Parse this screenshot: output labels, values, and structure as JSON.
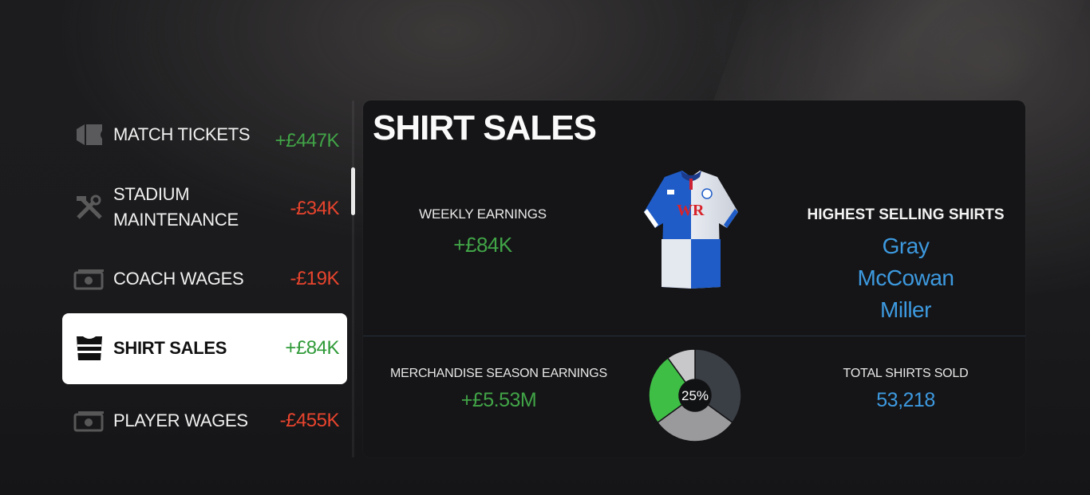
{
  "sidebar": {
    "items": [
      {
        "label_lines": [
          "MATCH TICKETS"
        ],
        "amount": "+£447K",
        "sign": "positive",
        "icon": "ticket-icon",
        "active": false
      },
      {
        "label_lines": [
          "STADIUM",
          "MAINTENANCE"
        ],
        "amount": "-£34K",
        "sign": "negative",
        "icon": "wrench-hammer-icon",
        "active": false
      },
      {
        "label_lines": [
          "COACH WAGES"
        ],
        "amount": "-£19K",
        "sign": "negative",
        "icon": "cash-icon",
        "active": false
      },
      {
        "label_lines": [
          "SHIRT SALES"
        ],
        "amount": "+£84K",
        "sign": "positive",
        "icon": "shirt-icon",
        "active": true
      },
      {
        "label_lines": [
          "PLAYER WAGES"
        ],
        "amount": "-£455K",
        "sign": "negative",
        "icon": "cash-icon",
        "active": false
      }
    ]
  },
  "panel": {
    "title": "SHIRT SALES",
    "weekly_earnings": {
      "label": "WEEKLY EARNINGS",
      "value": "+£84K"
    },
    "highest_selling": {
      "title": "HIGHEST SELLING SHIRTS",
      "names": [
        "Gray",
        "McCowan",
        "Miller"
      ]
    },
    "season_earnings": {
      "label": "MERCHANDISE SEASON EARNINGS",
      "value": "+£5.53M"
    },
    "total_sold": {
      "label": "TOTAL SHIRTS SOLD",
      "value": "53,218"
    },
    "donut": {
      "center_label": "25%",
      "segments": [
        {
          "fraction": 0.35,
          "color": "#3a3e45"
        },
        {
          "fraction": 0.3,
          "color": "#9a9a9c"
        },
        {
          "fraction": 0.25,
          "color": "#3fbe46"
        },
        {
          "fraction": 0.1,
          "color": "#c8c8ca"
        }
      ]
    },
    "shirt_sponsor": "WR"
  },
  "colors": {
    "positive": "#41a447",
    "negative": "#e8442d",
    "accent_blue": "#3d9ae0"
  }
}
